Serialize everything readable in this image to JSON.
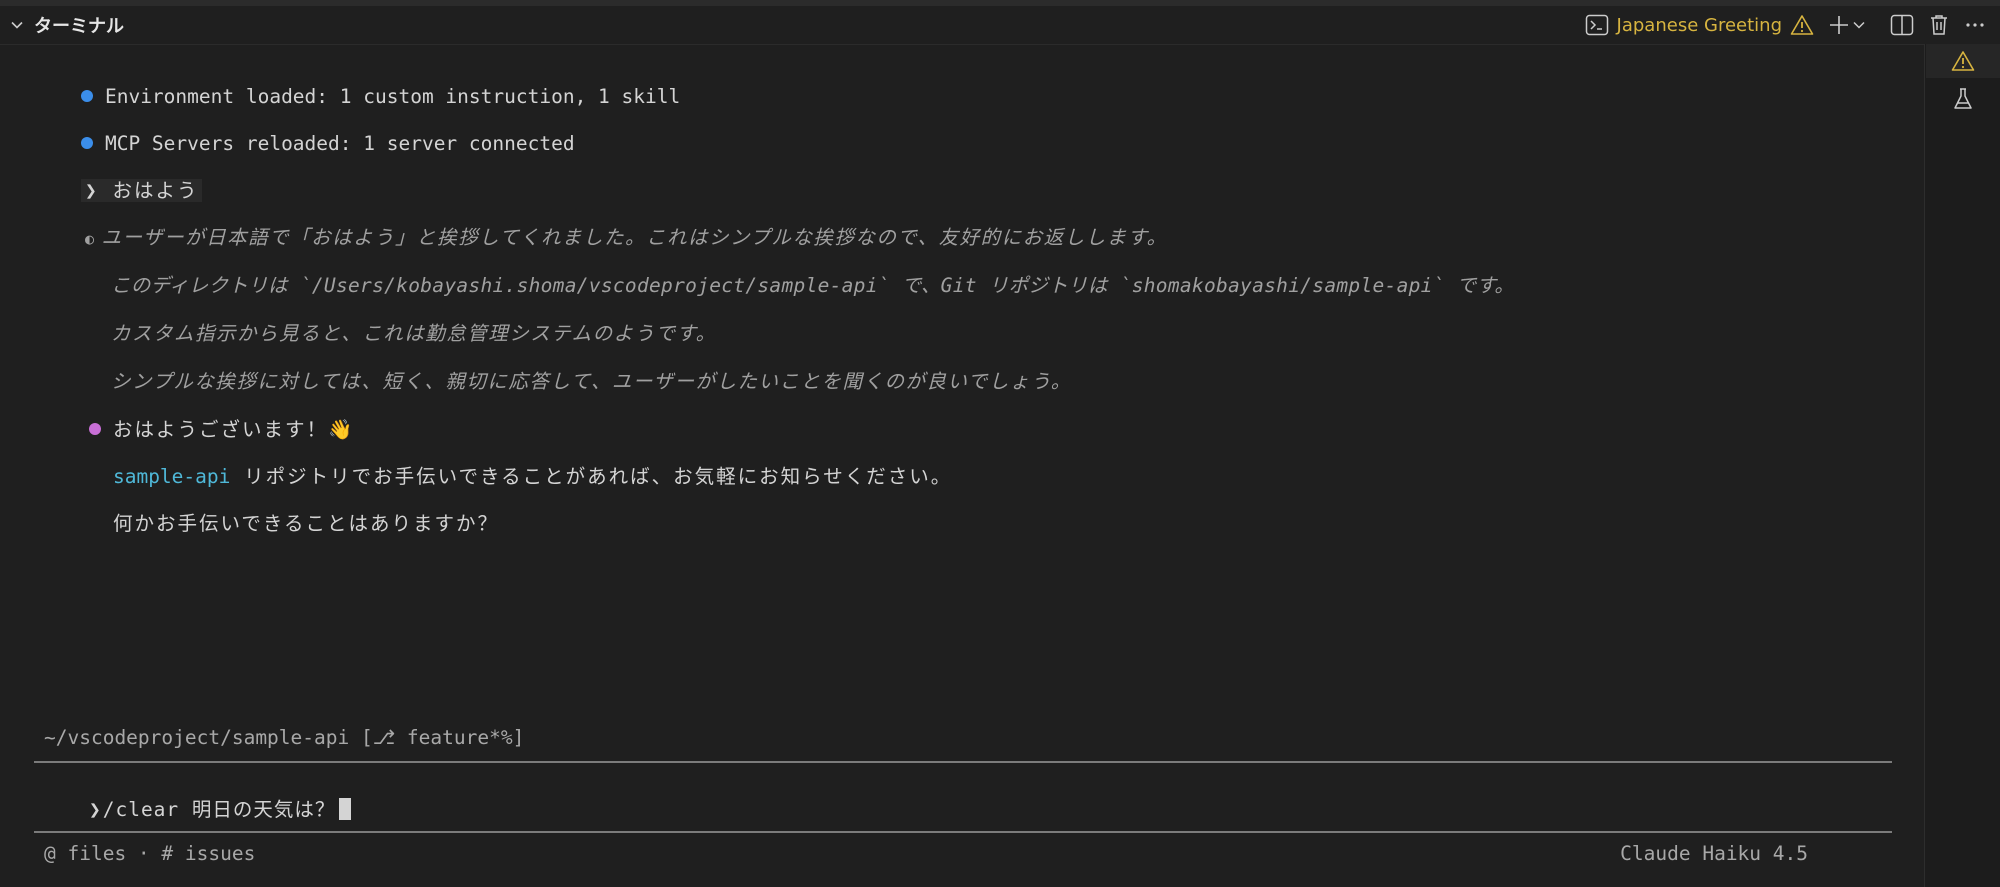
{
  "header": {
    "panel_title": "ターミナル",
    "terminal_name": "Japanese Greeting",
    "accent_color": "#d7b440"
  },
  "output": {
    "env_loaded": "Environment loaded: 1 custom instruction, 1 skill",
    "mcp_reloaded": "MCP Servers reloaded: 1 server connected",
    "user_prompt_symbol": "❯",
    "user_prompt": "おはよう",
    "thinking_symbol": "◐",
    "thinking": [
      "ユーザーが日本語で「おはよう」と挨拶してくれました。これはシンプルな挨拶なので、友好的にお返しします。",
      "このディレクトリは `/Users/kobayashi.shoma/vscodeproject/sample-api` で、Git リポジトリは `shomakobayashi/sample-api` です。",
      "カスタム指示から見ると、これは勤怠管理システムのようです。",
      "シンプルな挨拶に対しては、短く、親切に応答して、ユーザーがしたいことを聞くのが良いでしょう。"
    ],
    "reply_greeting": "おはようございます！👋",
    "reply_repo_name": "sample-api",
    "reply_line2_rest": " リポジトリでお手伝いできることがあれば、お気軽にお知らせください。",
    "reply_line3": "何かお手伝いできることはありますか？",
    "dot_colors": {
      "info": "#3b8eea",
      "reply": "#c86fd6"
    }
  },
  "status": {
    "cwd": "~/vscodeproject/sample-api [⎇ feature*%]"
  },
  "input": {
    "prompt_symbol": "❯",
    "value": "/clear 明日の天気は？"
  },
  "footer": {
    "hints": "@ files · # issues",
    "model": "Claude Haiku 4.5"
  }
}
